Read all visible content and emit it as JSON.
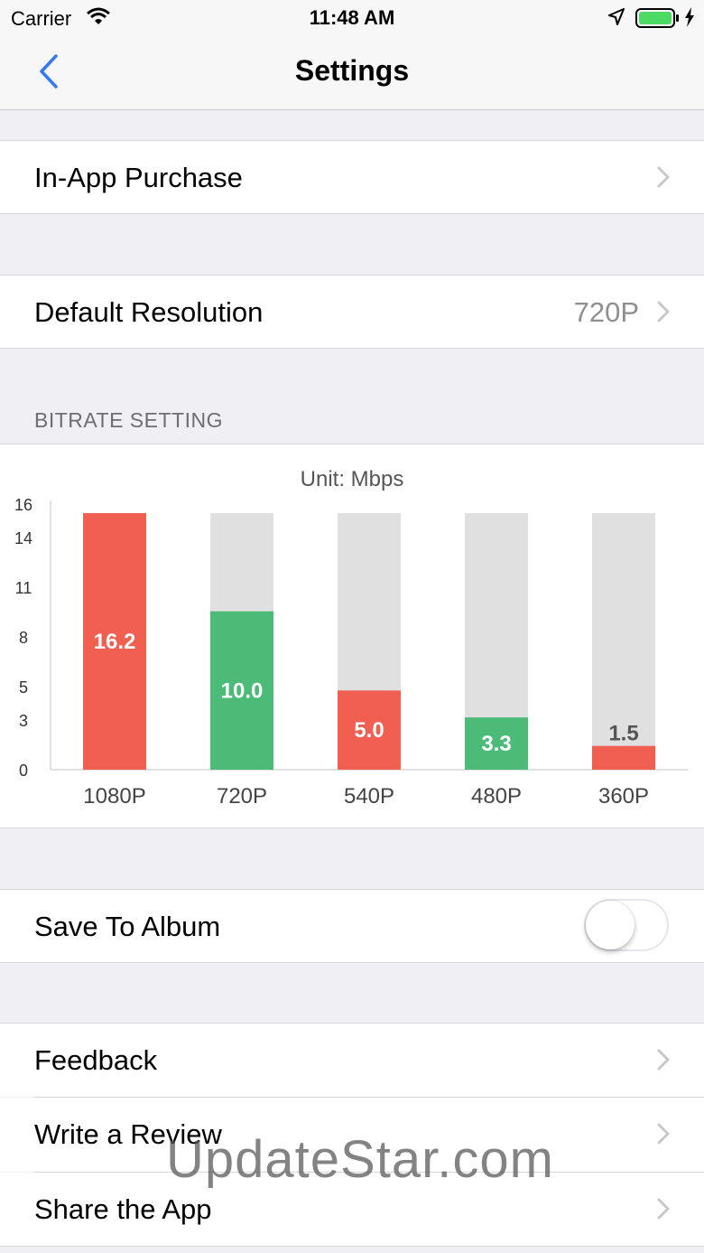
{
  "status_bar": {
    "carrier": "Carrier",
    "time": "11:48 AM"
  },
  "nav": {
    "title": "Settings",
    "back_icon": "chevron-left-icon"
  },
  "rows": {
    "in_app_purchase": "In-App Purchase",
    "default_resolution": {
      "label": "Default Resolution",
      "value": "720P"
    }
  },
  "bitrate": {
    "section_title": "BITRATE SETTING",
    "unit_label": "Unit: Mbps"
  },
  "chart_data": {
    "type": "bar",
    "title": "Unit: Mbps",
    "categories": [
      "1080P",
      "720P",
      "540P",
      "480P",
      "360P"
    ],
    "values": [
      16.2,
      10.0,
      5.0,
      3.3,
      1.5
    ],
    "value_labels": [
      "16.2",
      "10.0",
      "5.0",
      "3.3",
      "1.5"
    ],
    "bar_colors": [
      "#f05f50",
      "#4cbb77",
      "#f05f50",
      "#4cbb77",
      "#f05f50"
    ],
    "track_color": "#e0e0e0",
    "y_ticks": [
      0,
      3,
      5,
      8,
      11,
      14,
      16
    ],
    "ylim": [
      0,
      16.2
    ],
    "grid": false
  },
  "save_to_album": {
    "label": "Save To Album",
    "enabled": false
  },
  "links": [
    "Feedback",
    "Write a Review",
    "Share the App"
  ],
  "watermark": "UpdateStar.com",
  "colors": {
    "accent": "#3478f6",
    "chevron": "#c7c7cc",
    "background": "#efeff4"
  }
}
